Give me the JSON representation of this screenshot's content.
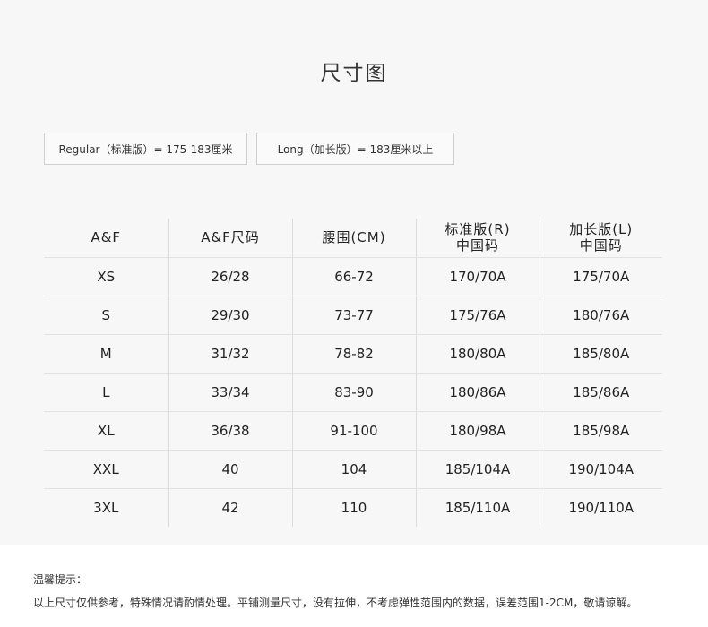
{
  "title": "尺寸图",
  "badges": {
    "regular": "Regular（标准版）= 175-183厘米",
    "long": "Long（加长版）= 183厘米以上"
  },
  "table": {
    "headers": [
      [
        "A&F"
      ],
      [
        "A&F尺码"
      ],
      [
        "腰围(CM)"
      ],
      [
        "标准版(R)",
        "中国码"
      ],
      [
        "加长版(L)",
        "中国码"
      ]
    ],
    "rows": [
      [
        "XS",
        "26/28",
        "66-72",
        "170/70A",
        "175/70A"
      ],
      [
        "S",
        "29/30",
        "73-77",
        "175/76A",
        "180/76A"
      ],
      [
        "M",
        "31/32",
        "78-82",
        "180/80A",
        "185/80A"
      ],
      [
        "L",
        "33/34",
        "83-90",
        "180/86A",
        "185/86A"
      ],
      [
        "XL",
        "36/38",
        "91-100",
        "180/98A",
        "185/98A"
      ],
      [
        "XXL",
        "40",
        "104",
        "185/104A",
        "190/104A"
      ],
      [
        "3XL",
        "42",
        "110",
        "185/110A",
        "190/110A"
      ]
    ]
  },
  "notes": {
    "title": "温馨提示：",
    "text": "以上尺寸仅供参考，特殊情况请酌情处理。平铺测量尺寸，没有拉伸，不考虑弹性范围内的数据，误差范围1-2CM，敬请谅解。"
  }
}
